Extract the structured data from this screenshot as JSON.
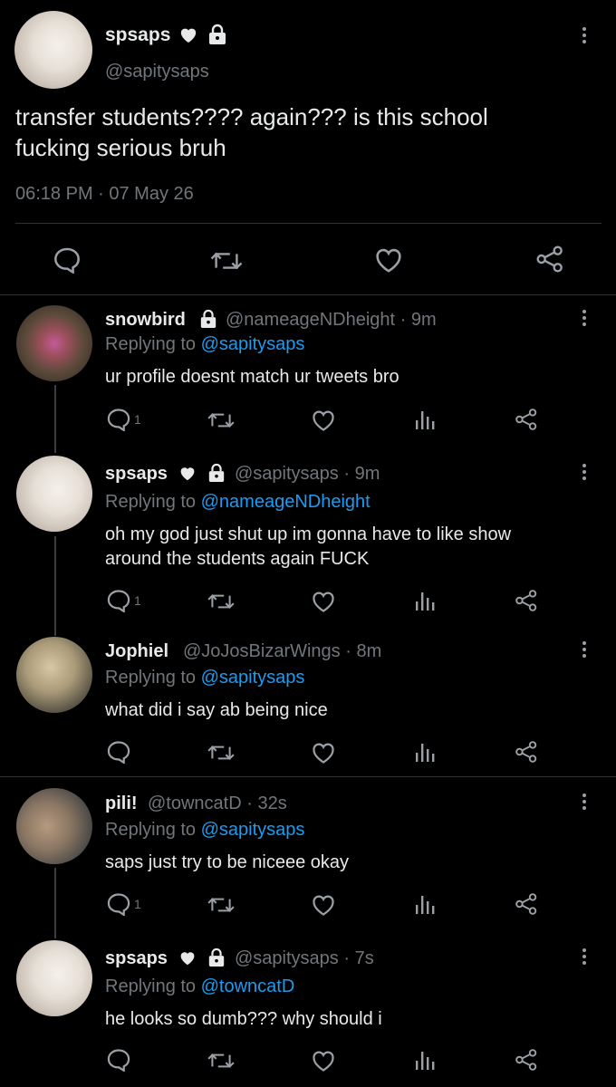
{
  "main_tweet": {
    "display_name": "spsaps",
    "handle": "@sapitysaps",
    "text_line1": "transfer students???? again??? is this school",
    "text_line2": "fucking serious bruh",
    "timestamp": "06:18 PM · 07 May 26"
  },
  "replies": [
    {
      "display_name": "snowbird",
      "meta": "@nameageNDheight · 9m",
      "replying_prefix": "Replying to",
      "replying_to": "@sapitysaps",
      "text_line1": "ur profile doesnt match ur tweets bro",
      "text_line2": "",
      "reply_count": "1"
    },
    {
      "display_name": "spsaps",
      "meta": "@sapitysaps · 9m",
      "replying_prefix": "Replying to",
      "replying_to": "@nameageNDheight",
      "text_line1": "oh my god just shut up im gonna have to like show",
      "text_line2": "around the students again FUCK",
      "reply_count": "1"
    },
    {
      "display_name": "Jophiel",
      "meta": "@JoJosBizarWings · 8m",
      "replying_prefix": "Replying to",
      "replying_to": "@sapitysaps",
      "text_line1": "what did i say ab being nice",
      "text_line2": "",
      "reply_count": ""
    },
    {
      "display_name": "pili!",
      "meta": "@towncatD · 32s",
      "replying_prefix": "Replying to",
      "replying_to": "@sapitysaps",
      "text_line1": "saps just try to be niceee okay",
      "text_line2": "",
      "reply_count": "1"
    },
    {
      "display_name": "spsaps",
      "meta": "@sapitysaps · 7s",
      "replying_prefix": "Replying to",
      "replying_to": "@towncatD",
      "text_line1": "he looks so dumb??? why should i",
      "text_line2": "",
      "reply_count": ""
    }
  ],
  "colors": {
    "background": "#000000",
    "text": "#e7e9ea",
    "muted": "#71767b",
    "link": "#1d9bf0",
    "divider": "#2f3336"
  }
}
